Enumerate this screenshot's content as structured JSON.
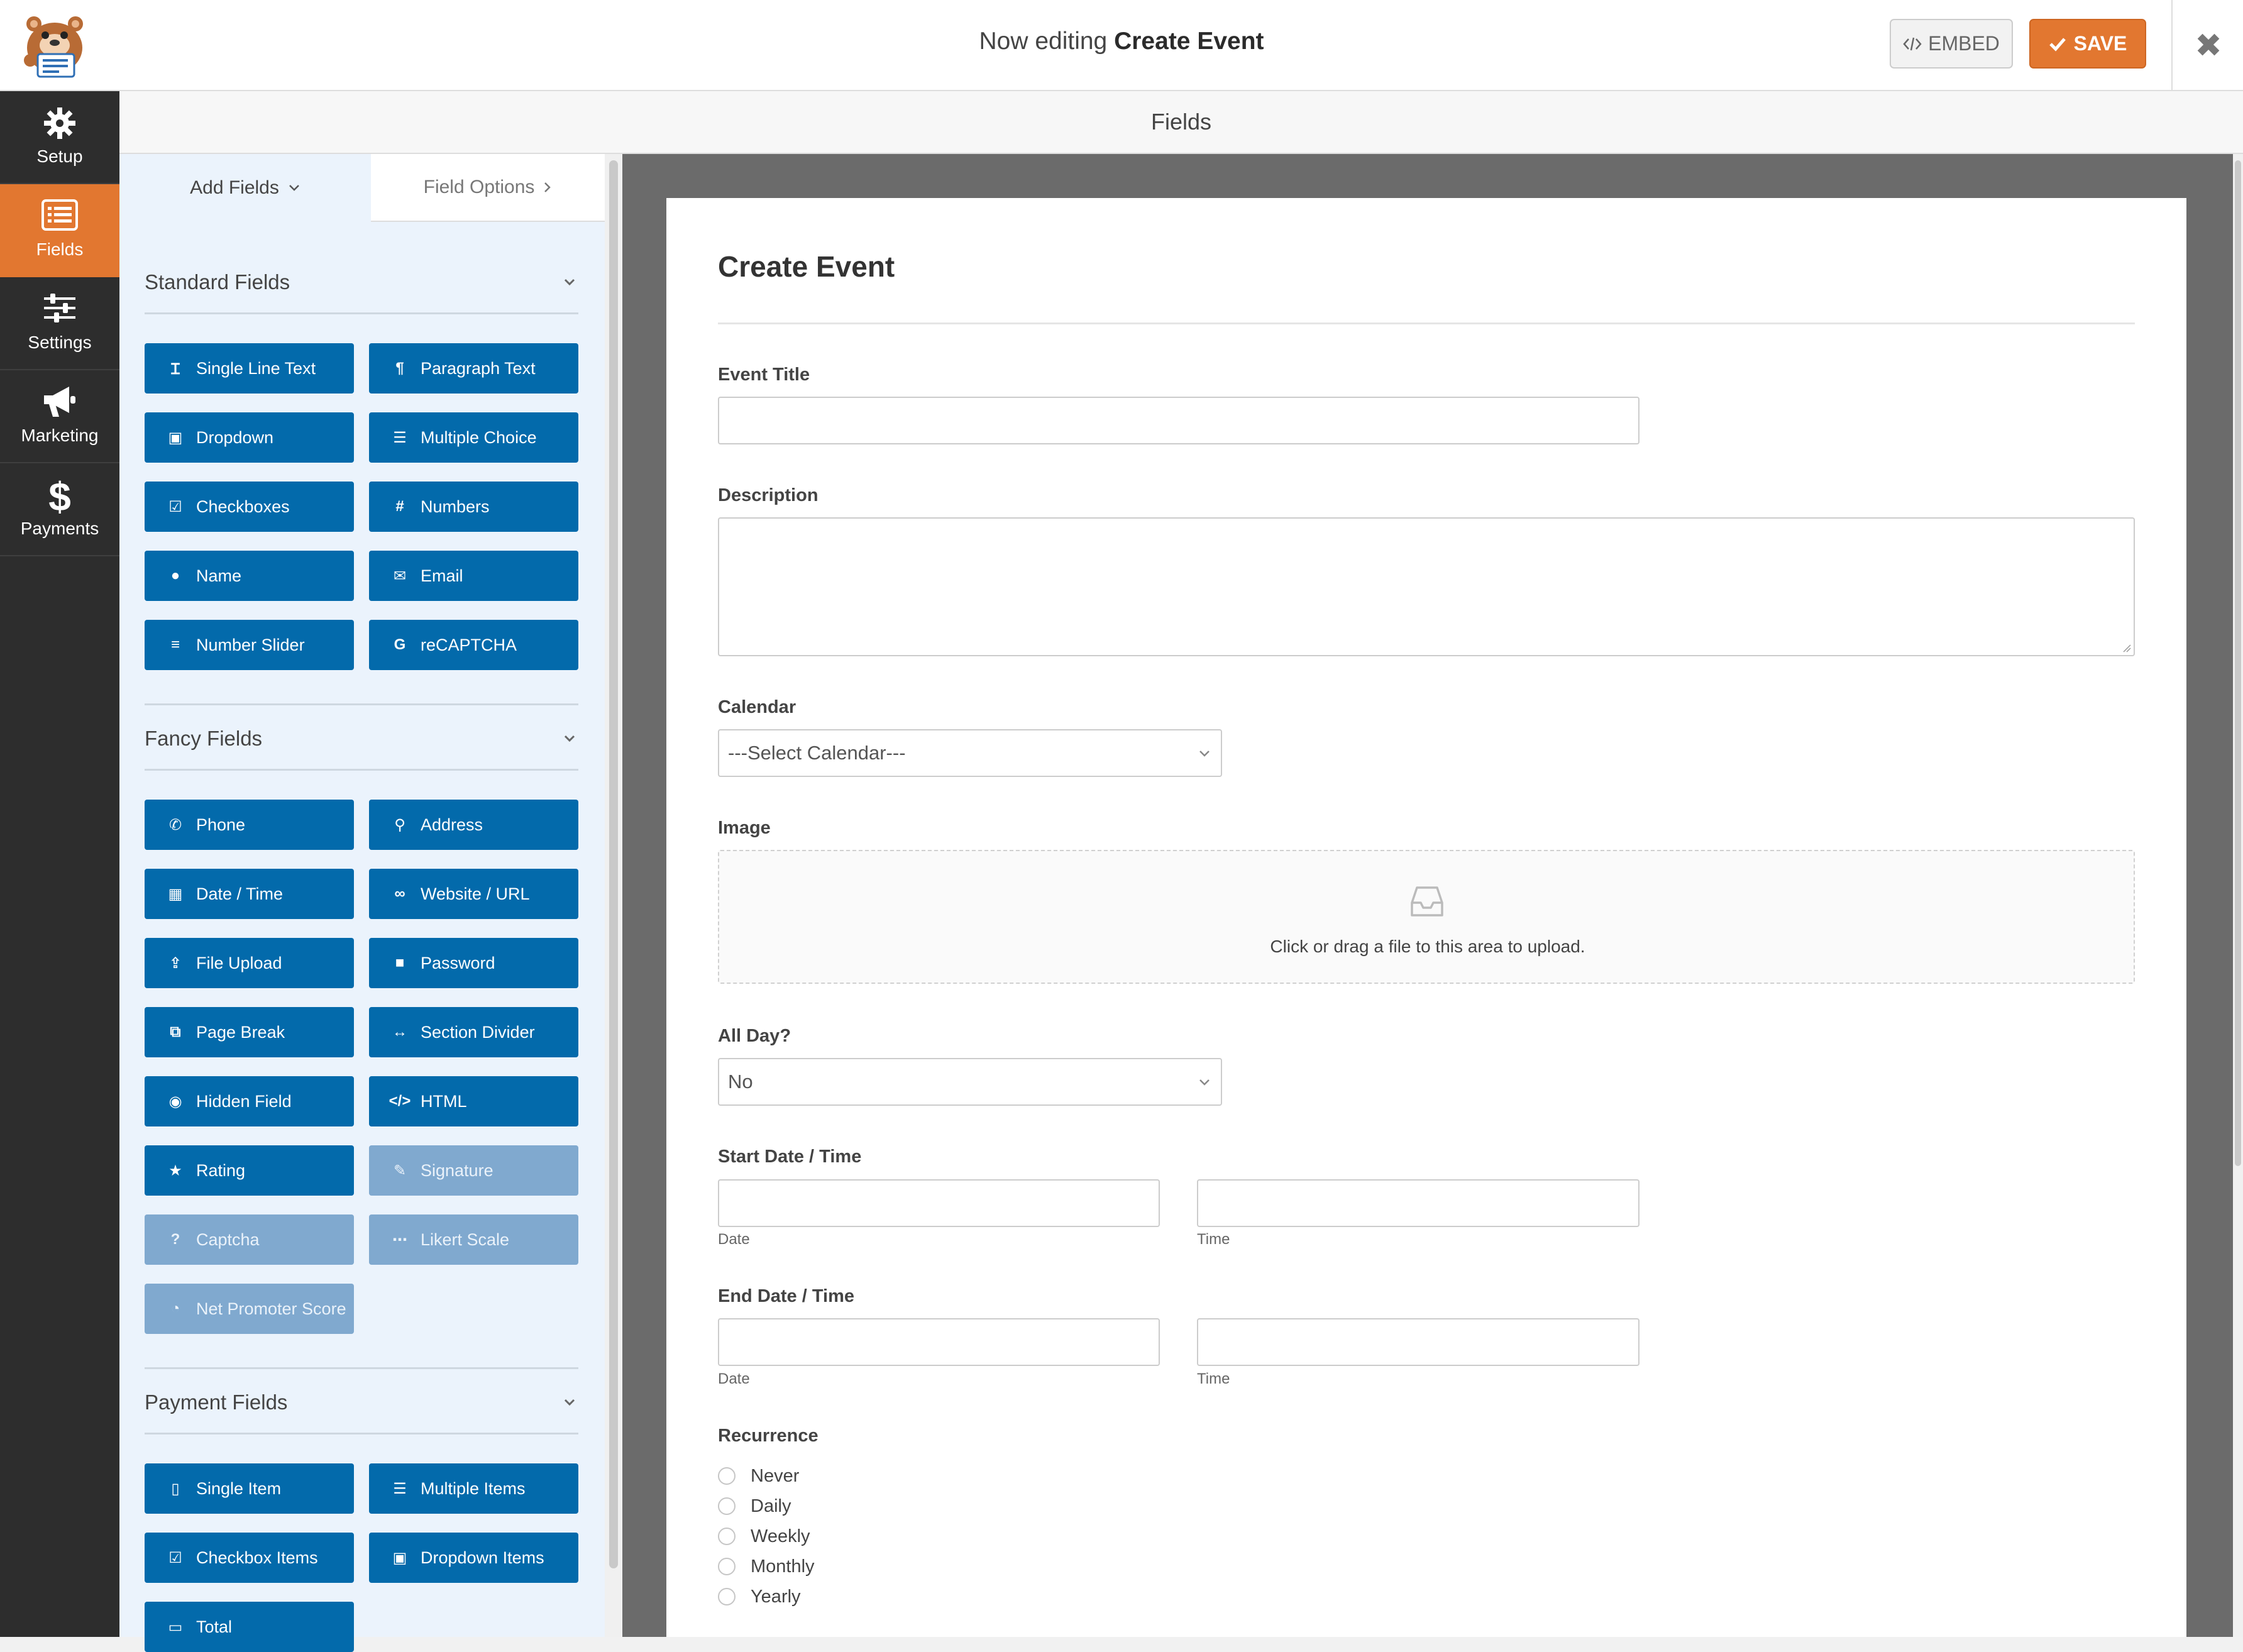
{
  "header": {
    "title_prefix": "Now editing",
    "title_form": "Create Event",
    "embed_label": "EMBED",
    "save_label": "SAVE"
  },
  "sidenav": {
    "items": [
      {
        "label": "Setup",
        "icon": "gear-icon"
      },
      {
        "label": "Fields",
        "icon": "fields-list-icon",
        "active": true
      },
      {
        "label": "Settings",
        "icon": "sliders-icon"
      },
      {
        "label": "Marketing",
        "icon": "megaphone-icon"
      },
      {
        "label": "Payments",
        "icon": "dollar-icon"
      }
    ]
  },
  "section_title": "Fields",
  "panel": {
    "tabs": {
      "add": "Add Fields",
      "options": "Field Options"
    },
    "standard": {
      "title": "Standard Fields",
      "buttons": [
        "Single Line Text",
        "Paragraph Text",
        "Dropdown",
        "Multiple Choice",
        "Checkboxes",
        "Numbers",
        "Name",
        "Email",
        "Number Slider",
        "reCAPTCHA"
      ]
    },
    "fancy": {
      "title": "Fancy Fields",
      "buttons": [
        "Phone",
        "Address",
        "Date / Time",
        "Website / URL",
        "File Upload",
        "Password",
        "Page Break",
        "Section Divider",
        "Hidden Field",
        "HTML",
        "Rating",
        "Signature",
        "Captcha",
        "Likert Scale",
        "Net Promoter Score"
      ]
    },
    "payment": {
      "title": "Payment Fields",
      "buttons": [
        "Single Item",
        "Multiple Items",
        "Checkbox Items",
        "Dropdown Items",
        "Total"
      ]
    }
  },
  "form": {
    "title": "Create Event",
    "event_title_label": "Event Title",
    "description_label": "Description",
    "calendar_label": "Calendar",
    "calendar_value": "---Select Calendar---",
    "image_label": "Image",
    "upload_text": "Click or drag a file to this area to upload.",
    "allday_label": "All Day?",
    "allday_value": "No",
    "start_label": "Start Date / Time",
    "end_label": "End Date / Time",
    "date_sub": "Date",
    "time_sub": "Time",
    "recurrence_label": "Recurrence",
    "recurrence_options": [
      "Never",
      "Daily",
      "Weekly",
      "Monthly",
      "Yearly"
    ]
  },
  "colors": {
    "accent": "#e27730",
    "field_button": "#036aab",
    "field_button_disabled": "#80a9cf",
    "sidenav": "#2d2d2d"
  }
}
